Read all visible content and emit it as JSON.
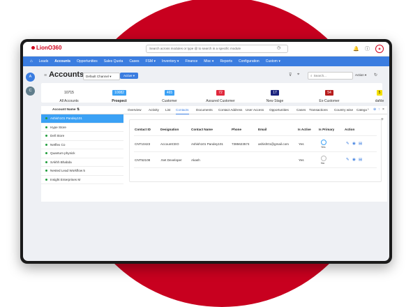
{
  "colors": {
    "brand_red": "#c8001f",
    "nav_blue": "#3b7de0",
    "selected_blue": "#3ba1f5"
  },
  "app": {
    "logo": "LionO360",
    "search_placeholder": "Search across modules or type @ to search in a specific module"
  },
  "nav": {
    "items": [
      "Leads",
      "Accounts",
      "Opportunities",
      "Sales Quota",
      "Cases",
      "FSM",
      "Inventory",
      "Finance",
      "Misc",
      "Reports",
      "Configuration",
      "Custom"
    ]
  },
  "sidebar": {
    "btn_a": "A",
    "btn_c": "C"
  },
  "page": {
    "title": "Accounts",
    "channel": "Default Channel",
    "status_button": "Active",
    "search_placeholder": "Search...",
    "action_label": "Action"
  },
  "stats": [
    {
      "value": "10715",
      "label": "All Accounts",
      "color": "#ffffff"
    },
    {
      "value": "10082",
      "label": "Prospect",
      "color": "#3ba1f5"
    },
    {
      "value": "465",
      "label": "Customer",
      "color": "#3ba1f5"
    },
    {
      "value": "72",
      "label": "Assured Customer",
      "color": "#e0283c"
    },
    {
      "value": "17",
      "label": "New Stage",
      "color": "#1a237e"
    },
    {
      "value": "54",
      "label": "Ex-Customer",
      "color": "#b71c1c"
    },
    {
      "value": "5",
      "label": "dafde",
      "color": "#f5e000"
    }
  ],
  "account_list": {
    "header": "Account Name",
    "items": [
      "Ashish101 Pandey101",
      "Hype Store",
      "Dell Store",
      "Netflex Co",
      "Quantum physick",
      "SAkhh Bhabda",
      "Nested Lead Workflow 5",
      "Insight Enterprises M"
    ]
  },
  "tabs": [
    "Overview",
    "Activity",
    "List",
    "Contacts",
    "Documents",
    "Contact Address",
    "User Access",
    "Opportunities",
    "Cases",
    "Transactions",
    "Country wise",
    "Catego"
  ],
  "contacts": {
    "columns": [
      "Contact ID",
      "Designation",
      "Contact Name",
      "Phone",
      "Email",
      "Is Active",
      "Is Primary",
      "Action"
    ],
    "rows": [
      {
        "id": "CNT10423",
        "designation": "AccountCEO",
        "name": "Ashish101 Pandey101",
        "phone": "7385623574",
        "email": "ashish01@gmail.com",
        "active": "Yes",
        "primary": "Yes"
      },
      {
        "id": "CNT52108",
        "designation": ".Net Developer",
        "name": "Akash",
        "phone": "",
        "email": "",
        "active": "Yes",
        "primary": "No"
      }
    ]
  }
}
